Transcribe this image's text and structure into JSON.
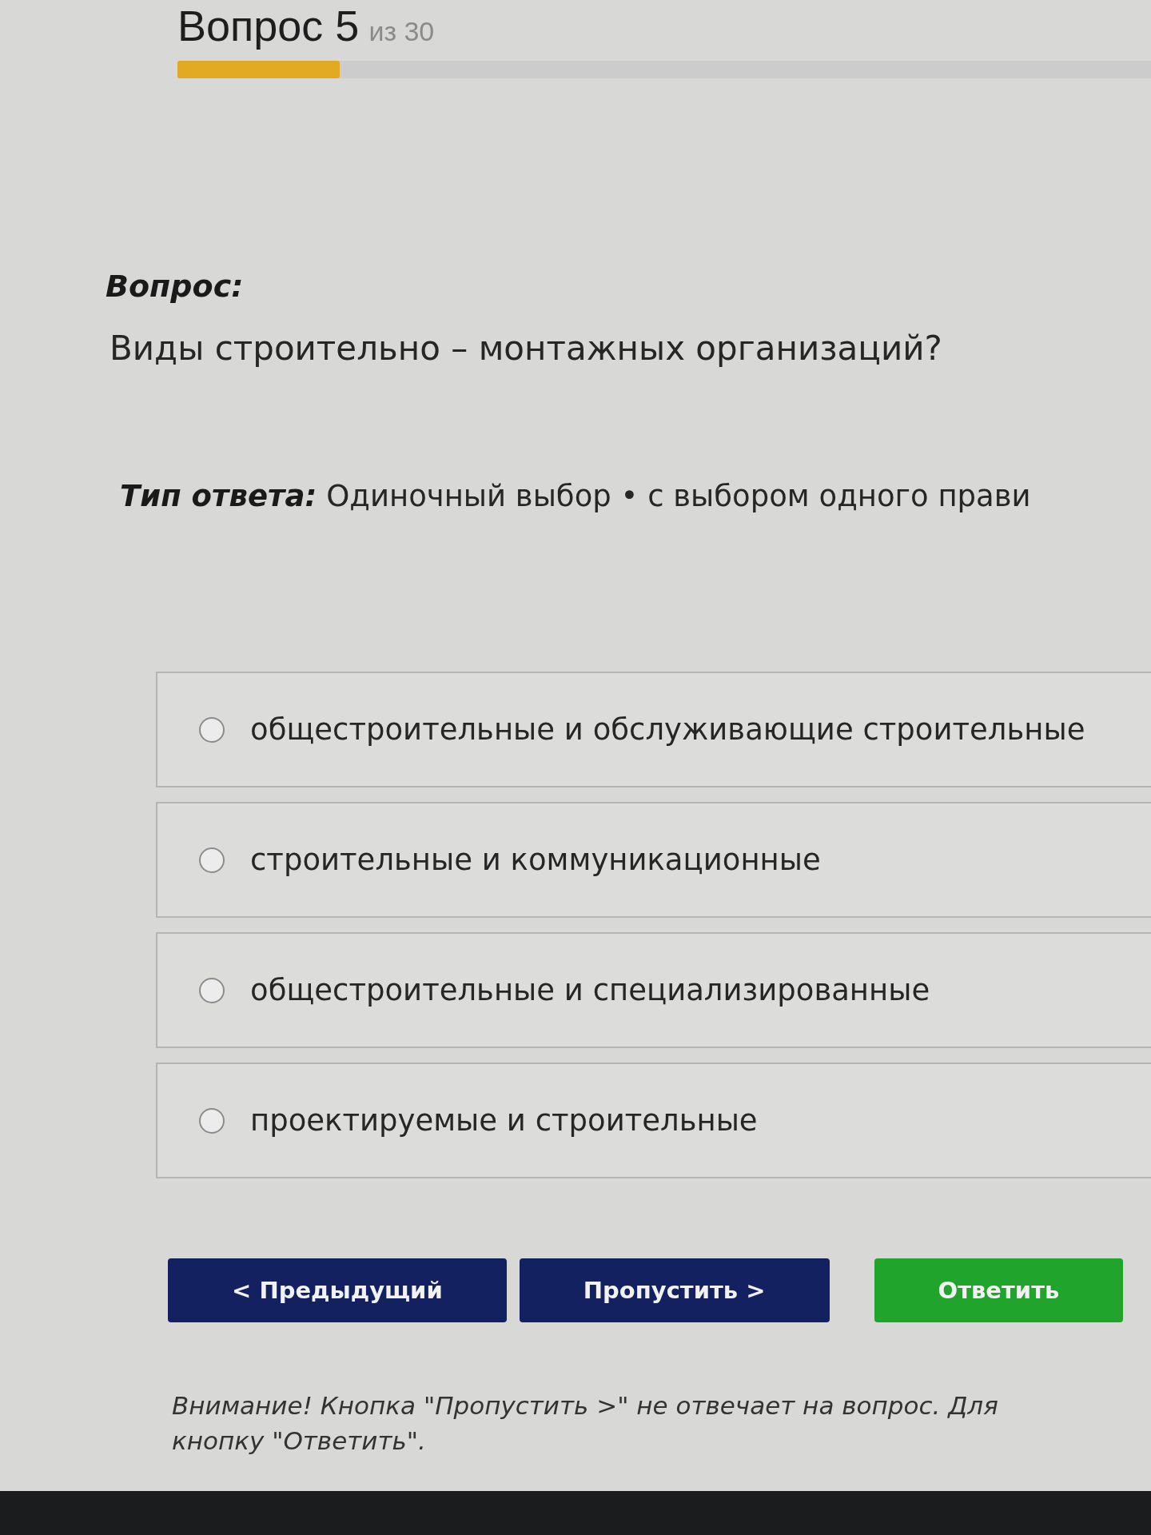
{
  "header": {
    "title": "Вопрос 5",
    "counter": "из 30",
    "progress": {
      "level": 0.167
    }
  },
  "question": {
    "label": "Вопрос:",
    "text": "Виды строительно – монтажных организаций?"
  },
  "answer_type": {
    "label": "Тип ответа:",
    "text": "Одиночный выбор • с выбором одного прави"
  },
  "options": [
    {
      "text": "общестроительные и обслуживающие строительные",
      "selected": false
    },
    {
      "text": "строительные и коммуникационные",
      "selected": false
    },
    {
      "text": "общестроительные и специализированные",
      "selected": false
    },
    {
      "text": "проектируемые и строительные",
      "selected": false
    }
  ],
  "buttons": [
    {
      "label": "< Предыдущий",
      "kind": "secondary"
    },
    {
      "label": "Пропустить >",
      "kind": "secondary"
    },
    {
      "label": "Ответить",
      "kind": "primary"
    }
  ],
  "notice": {
    "lines": [
      "Внимание! Кнопка \"Пропустить >\" не отвечает на вопрос. Для",
      "кнопку \"Ответить\"."
    ]
  }
}
